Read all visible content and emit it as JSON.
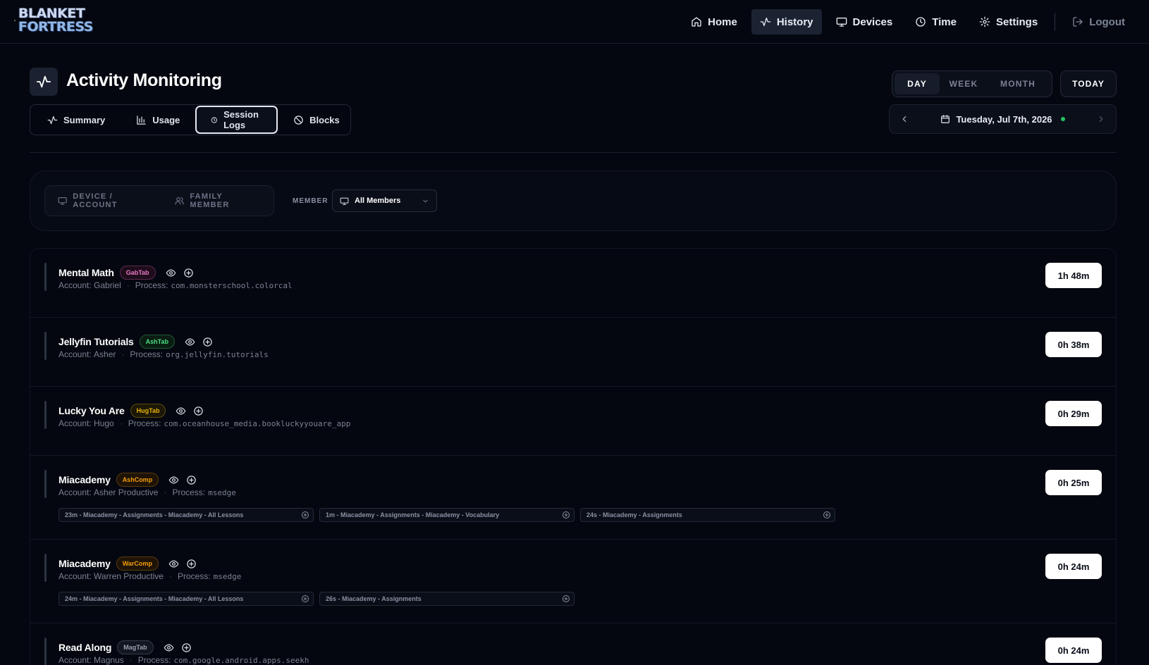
{
  "app": {
    "logo_line1": "BLANKET",
    "logo_line2": "FORTRESS"
  },
  "nav": {
    "items": [
      {
        "label": "Home",
        "icon": "home-icon",
        "active": false
      },
      {
        "label": "History",
        "icon": "activity-icon",
        "active": true
      },
      {
        "label": "Devices",
        "icon": "monitor-icon",
        "active": false
      },
      {
        "label": "Time",
        "icon": "clock-icon",
        "active": false
      },
      {
        "label": "Settings",
        "icon": "gear-icon",
        "active": false
      }
    ],
    "logout": "Logout"
  },
  "header": {
    "title": "Activity Monitoring",
    "tabs": [
      {
        "label": "Summary",
        "icon": "activity-icon"
      },
      {
        "label": "Usage",
        "icon": "bar-chart-icon"
      },
      {
        "label": "Session Logs",
        "icon": "clock-icon",
        "active": true
      },
      {
        "label": "Blocks",
        "icon": "ban-icon"
      }
    ],
    "range": {
      "day": "DAY",
      "week": "WEEK",
      "month": "MONTH",
      "active": "day"
    },
    "today": "TODAY",
    "date": "Tuesday, Jul 7th, 2026"
  },
  "filters": {
    "device_account": "DEVICE / ACCOUNT",
    "family_member": "FAMILY MEMBER",
    "member_label": "MEMBER",
    "member_value": "All Members"
  },
  "colors": {
    "badge_pink": "#e879c6",
    "badge_green": "#4ade80",
    "badge_yellow": "#eab308",
    "badge_orange": "#f59e0b",
    "badge_gray": "#9aa1b0"
  },
  "sessions": [
    {
      "name": "Mental Math",
      "badge": "GabTab",
      "badge_color": "#e879c6",
      "account_label": "Account:",
      "account": "Gabriel",
      "process_label": "Process:",
      "process": "com.monsterschool.colorcal",
      "duration": "1h 48m",
      "chips": []
    },
    {
      "name": "Jellyfin Tutorials",
      "badge": "AshTab",
      "badge_color": "#4ade80",
      "account_label": "Account:",
      "account": "Asher",
      "process_label": "Process:",
      "process": "org.jellyfin.tutorials",
      "duration": "0h 38m",
      "chips": []
    },
    {
      "name": "Lucky You Are",
      "badge": "HugTab",
      "badge_color": "#eab308",
      "account_label": "Account:",
      "account": "Hugo",
      "process_label": "Process:",
      "process": "com.oceanhouse_media.bookluckyyouare_app",
      "duration": "0h 29m",
      "chips": []
    },
    {
      "name": "Miacademy",
      "badge": "AshComp",
      "badge_color": "#f59e0b",
      "account_label": "Account:",
      "account": "Asher Productive",
      "process_label": "Process:",
      "process": "msedge",
      "duration": "0h 25m",
      "chips": [
        "23m - Miacademy - Assignments - Miacademy - All Lessons",
        "1m - Miacademy - Assignments - Miacademy - Vocabulary",
        "24s - Miacademy - Assignments"
      ]
    },
    {
      "name": "Miacademy",
      "badge": "WarComp",
      "badge_color": "#f59e0b",
      "account_label": "Account:",
      "account": "Warren Productive",
      "process_label": "Process:",
      "process": "msedge",
      "duration": "0h 24m",
      "chips": [
        "24m - Miacademy - Assignments - Miacademy - All Lessons",
        "26s - Miacademy - Assignments"
      ]
    },
    {
      "name": "Read Along",
      "badge": "MagTab",
      "badge_color": "#9aa1b0",
      "account_label": "Account:",
      "account": "Magnus",
      "process_label": "Process:",
      "process": "com.google.android.apps.seekh",
      "duration": "0h 24m",
      "chips": []
    }
  ]
}
